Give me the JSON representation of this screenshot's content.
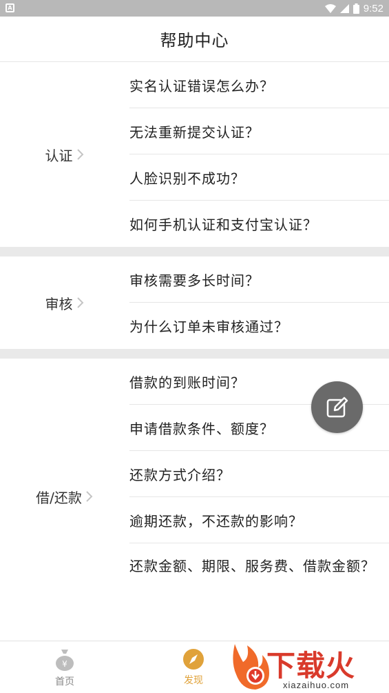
{
  "status_bar": {
    "time": "9:52"
  },
  "header": {
    "title": "帮助中心"
  },
  "sections": [
    {
      "label": "认证",
      "questions": [
        "实名认证错误怎么办？",
        "无法重新提交认证？",
        "人脸识别不成功？",
        "如何手机认证和支付宝认证？"
      ]
    },
    {
      "label": "审核",
      "questions": [
        "审核需要多长时间？",
        "为什么订单未审核通过？"
      ]
    },
    {
      "label": "借/还款",
      "questions": [
        "借款的到账时间？",
        "申请借款条件、额度？",
        "还款方式介绍？",
        "逾期还款，不还款的影响？",
        "还款金额、期限、服务费、借款金额？"
      ]
    }
  ],
  "tabbar": {
    "home_label": "首页",
    "discover_label": "发现"
  },
  "watermark": {
    "text": "下载火",
    "url": "xiazaihuo.com"
  },
  "colors": {
    "accent": "#e0a23a",
    "fab": "#6a6a6a",
    "divider": "#e9e9e9",
    "watermark": "#d93a2b"
  }
}
